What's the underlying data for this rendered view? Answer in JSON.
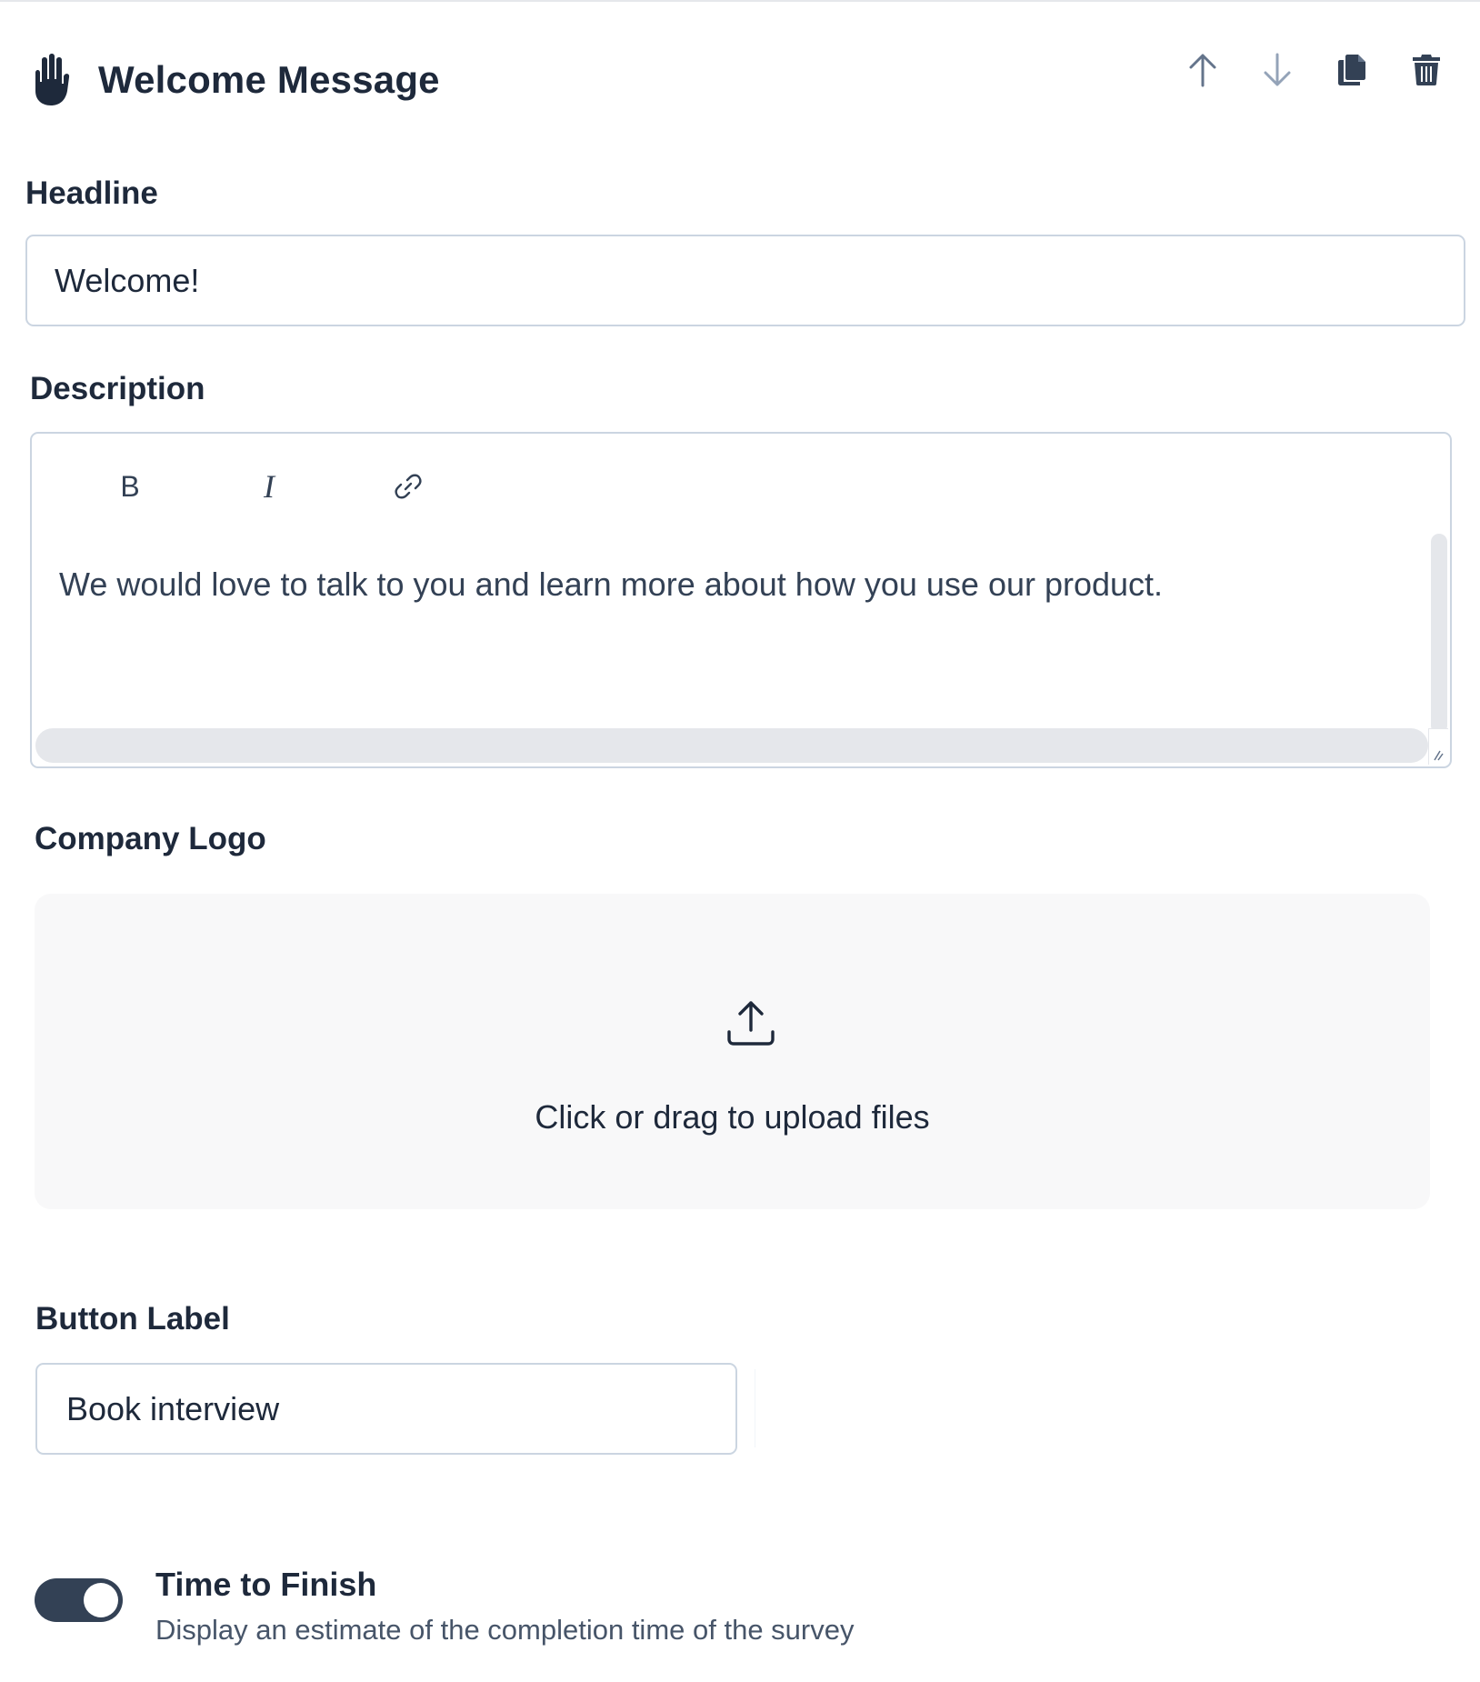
{
  "header": {
    "title": "Welcome Message",
    "icon": "hand-raised-icon",
    "actions": [
      {
        "name": "move-up",
        "icon": "arrow-up-icon"
      },
      {
        "name": "move-down",
        "icon": "arrow-down-icon"
      },
      {
        "name": "duplicate",
        "icon": "copy-icon"
      },
      {
        "name": "delete",
        "icon": "trash-icon"
      }
    ]
  },
  "headline": {
    "label": "Headline",
    "value": "Welcome!"
  },
  "description": {
    "label": "Description",
    "toolbar": {
      "bold": "B",
      "italic": "I",
      "link_icon": "link-icon"
    },
    "text": "We would love to talk to you and learn more about how you use our product."
  },
  "logo": {
    "label": "Company Logo",
    "upload_text": "Click or drag to upload files",
    "icon": "upload-icon"
  },
  "button_label": {
    "label": "Button Label",
    "value": "Book interview"
  },
  "time_to_finish": {
    "title": "Time to Finish",
    "description": "Display an estimate of the completion time of the survey",
    "enabled": true
  },
  "colors": {
    "text": "#1e293b",
    "border": "#cbd5e1",
    "toggle_on": "#334155",
    "upload_bg": "#f8f8f9"
  }
}
